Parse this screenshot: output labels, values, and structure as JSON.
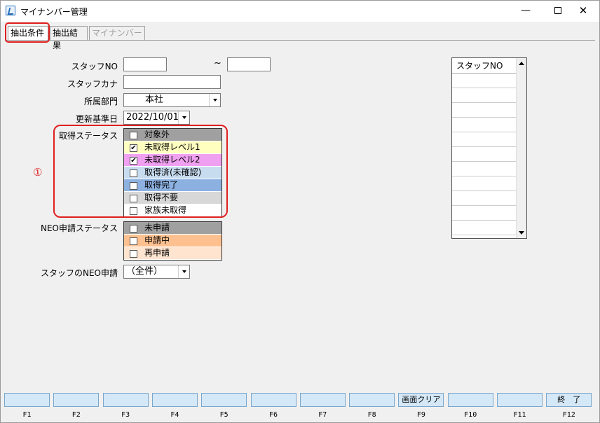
{
  "window": {
    "title": "マイナンバー管理",
    "min": "—",
    "close": "✕"
  },
  "tabs": [
    "抽出条件",
    "抽出結果",
    "マイナンバー"
  ],
  "form": {
    "staff_no_label": "スタッフNO",
    "staff_no_from": "",
    "tilde": "~",
    "staff_no_to": "",
    "staff_kana_label": "スタッフカナ",
    "staff_kana": "",
    "dept_label": "所属部門",
    "dept_value": "本社",
    "update_date_label": "更新基準日",
    "update_date_value": "2022/10/01",
    "acq_status_label": "取得ステータス",
    "neo_status_label": "NEO申請ステータス",
    "staff_neo_label": "スタッフのNEO申請",
    "staff_neo_value": "（全件）"
  },
  "acquisition_statuses": [
    {
      "label": "対象外",
      "checked": false,
      "color": "#a0a0a0"
    },
    {
      "label": "未取得レベル1",
      "checked": true,
      "color": "#ffffc0"
    },
    {
      "label": "未取得レベル2",
      "checked": true,
      "color": "#f0a0f0"
    },
    {
      "label": "取得済(未確認)",
      "checked": false,
      "color": "#c8dcf0"
    },
    {
      "label": "取得完了",
      "checked": false,
      "color": "#8cb0e0"
    },
    {
      "label": "取得不要",
      "checked": false,
      "color": "#d8d8d8"
    },
    {
      "label": "家族未取得",
      "checked": false,
      "color": "#ffffff"
    }
  ],
  "neo_statuses": [
    {
      "label": "未申請",
      "checked": false,
      "color": "#a0a0a0"
    },
    {
      "label": "申請中",
      "checked": false,
      "color": "#ffc090"
    },
    {
      "label": "再申請",
      "checked": false,
      "color": "#ffe4d0"
    }
  ],
  "annotation": {
    "number": "①"
  },
  "staff_list": {
    "header": "スタッフNO",
    "rows": 11
  },
  "function_keys": [
    {
      "key": "F1",
      "label": ""
    },
    {
      "key": "F2",
      "label": ""
    },
    {
      "key": "F3",
      "label": ""
    },
    {
      "key": "F4",
      "label": ""
    },
    {
      "key": "F5",
      "label": ""
    },
    {
      "key": "F6",
      "label": ""
    },
    {
      "key": "F7",
      "label": ""
    },
    {
      "key": "F8",
      "label": ""
    },
    {
      "key": "F9",
      "label": "画面クリア"
    },
    {
      "key": "F10",
      "label": ""
    },
    {
      "key": "F11",
      "label": ""
    },
    {
      "key": "F12",
      "label": "終　了"
    }
  ]
}
